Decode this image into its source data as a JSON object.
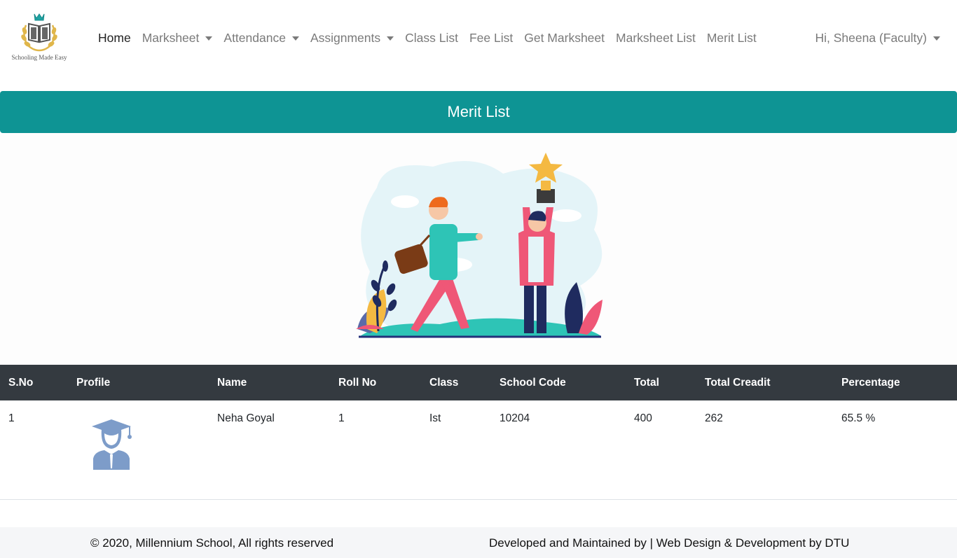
{
  "brand": {
    "tagline": "Schooling Made Easy"
  },
  "nav": {
    "home": "Home",
    "marksheet": "Marksheet",
    "attendance": "Attendance",
    "assignments": "Assignments",
    "class_list": "Class List",
    "fee_list": "Fee List",
    "get_marksheet": "Get Marksheet",
    "marksheet_list": "Marksheet List",
    "merit_list": "Merit List",
    "user": "Hi, Sheena (Faculty)"
  },
  "page": {
    "title": "Merit List"
  },
  "table": {
    "headers": [
      "S.No",
      "Profile",
      "Name",
      "Roll No",
      "Class",
      "School Code",
      "Total",
      "Total Creadit",
      "Percentage"
    ],
    "rows": [
      {
        "sno": "1",
        "name": "Neha Goyal",
        "roll_no": "1",
        "class": "Ist",
        "school_code": "10204",
        "total": "400",
        "total_credit": "262",
        "percentage": "65.5 %"
      }
    ]
  },
  "footer": {
    "left": "© 2020, Millennium School, All rights reserved",
    "right": "Developed and Maintained by | Web Design & Development by DTU"
  },
  "colors": {
    "accent": "#0e9494",
    "table_header": "#343a40",
    "footer_bg": "#f5f6f8"
  },
  "icons": {
    "logo": "open-book-crown-laurel-icon",
    "avatar": "graduate-avatar-icon",
    "hero": "trophy-celebration-illustration"
  }
}
